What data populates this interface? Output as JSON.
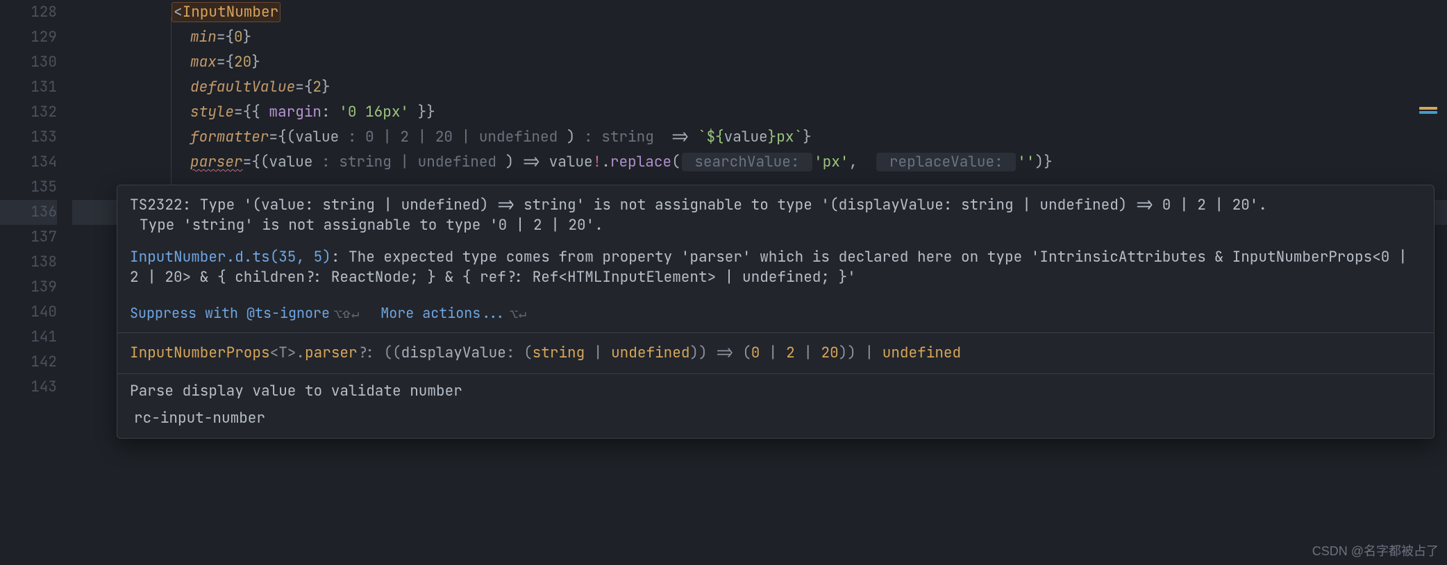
{
  "gutter": {
    "start": 128,
    "count": 16
  },
  "code": {
    "l128_lt": "<",
    "l128_tag": "InputNumber",
    "l129_attr": "min",
    "l129_eq": "=",
    "l129_b1": "{",
    "l129_v": "0",
    "l129_b2": "}",
    "l130_attr": "max",
    "l130_b1": "{",
    "l130_v": "20",
    "l130_b2": "}",
    "l131_attr": "defaultValue",
    "l131_b1": "{",
    "l131_v": "2",
    "l131_b2": "}",
    "l132_attr": "style",
    "l132_b1": "{{ ",
    "l132_key": "margin",
    "l132_colon": ": ",
    "l132_str": "'0 16px'",
    "l132_b2": " }}",
    "l133_attr": "formatter",
    "l133_b1": "{(",
    "l133_param": "value",
    "l133_hint1": " : 0 | 2 | 20 | undefined ",
    "l133_paren": ")",
    "l133_hint2": " : string ",
    "l133_arrow": " => ",
    "l133_tpl1": "`${",
    "l133_tplvar": "value",
    "l133_tpl2": "}",
    "l133_px": "px",
    "l133_tpl3": "`",
    "l133_b2": "}",
    "l134_attr": "parser",
    "l134_b1": "{(",
    "l134_param": "value",
    "l134_hint1": " : string | undefined ",
    "l134_paren": ")",
    "l134_arrow": " => ",
    "l134_val": "value",
    "l134_bang": "!",
    "l134_dot": ".",
    "l134_fn": "replace",
    "l134_p1": "(",
    "l134_hintA": " searchValue: ",
    "l134_str1": "'px'",
    "l134_comma": ",",
    "l134_hintB": " replaceValue: ",
    "l134_str2": "''",
    "l134_p2": ")}"
  },
  "popup": {
    "err1": "TS2322: Type '(value: string | undefined) => string' is not assignable to type '(displayValue: string | undefined) => 0 | 2 | 20'.",
    "err2": "Type 'string' is not assignable to type '0 | 2 | 20'.",
    "srcLink": "InputNumber.d.ts(35, 5)",
    "srcRest": ": The expected type comes from property 'parser' which is declared here on type 'IntrinsicAttributes & InputNumberProps<0 | 2 | 20> & { children?: ReactNode; } & { ref?: Ref<HTMLInputElement> | undefined; }'",
    "suppress": "Suppress with @ts-ignore",
    "suppressKey": "⌥⇧↵",
    "more": "More actions...",
    "moreKey": "⌥↵",
    "sig_type": "InputNumberProps",
    "sig_tparams": "<T>",
    "sig_dot": ".",
    "sig_prop": "parser",
    "sig_opt": "?: ((",
    "sig_p1": "displayValue",
    "sig_p2": ": (",
    "sig_s": "string",
    "sig_pipe": " | ",
    "sig_u": "undefined",
    "sig_close1": ")) => (",
    "sig_0": "0",
    "sig_2": "2",
    "sig_20": "20",
    "sig_close2": ")) | ",
    "sig_u2": "undefined",
    "doc": "Parse display value to validate number",
    "pkg": "rc-input-number"
  },
  "watermark": "CSDN @名字都被占了"
}
